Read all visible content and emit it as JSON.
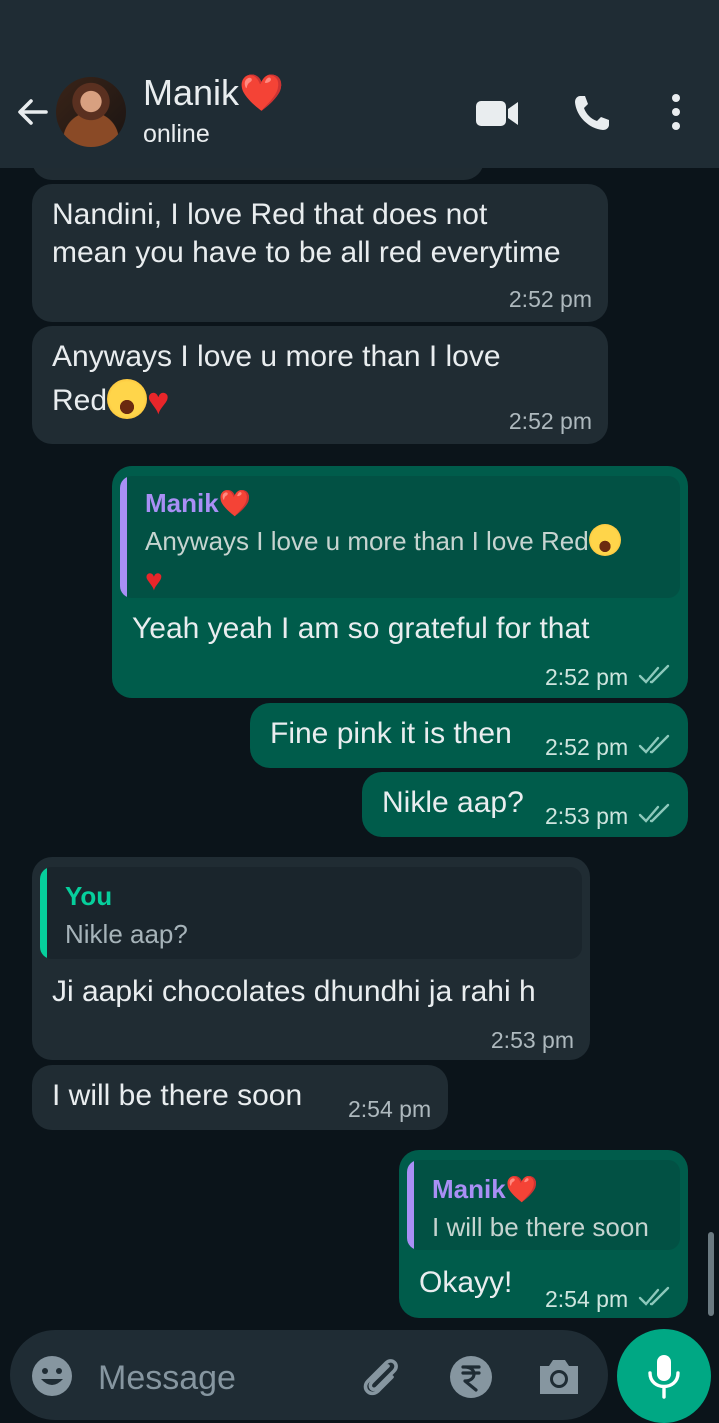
{
  "header": {
    "contact_name": "Manik",
    "name_emoji": "❤️",
    "status": "online"
  },
  "messages": [
    {
      "direction": "in",
      "text_line1": "Nandini, I love Red that does not",
      "text_line2": "mean you have to be all red everytime",
      "time": "2:52 pm"
    },
    {
      "direction": "in",
      "text_line1": "Anyways I love u more than I love",
      "text_line2": "Red",
      "time": "2:52 pm"
    },
    {
      "direction": "out",
      "quote_name": "Manik",
      "quote_line1": "Anyways I love u more than I love Red",
      "text": "Yeah yeah I am so grateful for that",
      "time": "2:52 pm"
    },
    {
      "direction": "out",
      "text": "Fine pink it is then",
      "time": "2:52 pm"
    },
    {
      "direction": "out",
      "text": "Nikle aap?",
      "time": "2:53 pm"
    },
    {
      "direction": "in",
      "quote_name": "You",
      "quote_line1": "Nikle aap?",
      "text": "Ji aapki chocolates dhundhi ja rahi h",
      "time": "2:53 pm"
    },
    {
      "direction": "in",
      "text": "I will be there soon",
      "time": "2:54 pm"
    },
    {
      "direction": "out",
      "quote_name": "Manik",
      "quote_line1": "I will be there soon",
      "text": "Okayy!",
      "time": "2:54 pm"
    }
  ],
  "composer": {
    "placeholder": "Message"
  },
  "colors": {
    "header_bg": "#1f2c34",
    "chat_bg": "#0b141a",
    "incoming_bubble": "#202c33",
    "outgoing_bubble": "#005c4b",
    "accent": "#00a884",
    "quote_name_purple": "#a98ff5",
    "quote_name_you": "#06cf9c",
    "read_ticks": "#8dc8bb"
  },
  "icons": [
    "back-arrow-icon",
    "video-call-icon",
    "phone-icon",
    "more-vert-icon",
    "emoji-icon",
    "attach-icon",
    "rupee-icon",
    "camera-icon",
    "mic-icon"
  ]
}
